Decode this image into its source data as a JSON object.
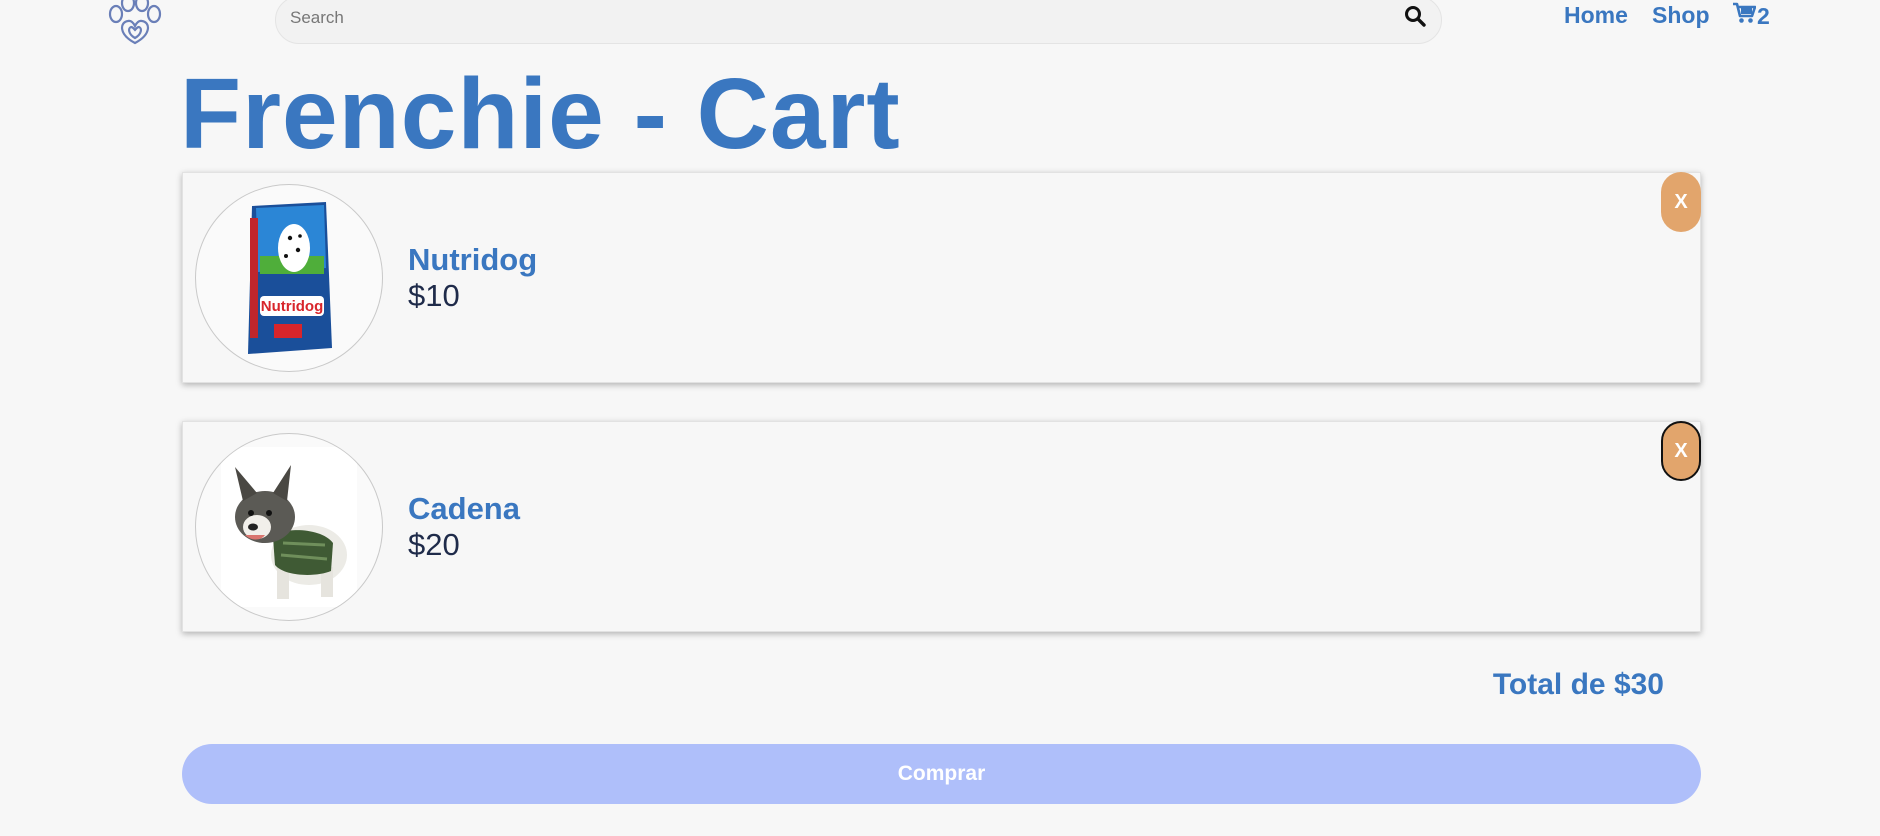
{
  "header": {
    "logo_icon": "paw-heart-logo-icon",
    "search": {
      "placeholder": "Search",
      "value": "",
      "icon": "search-icon"
    },
    "nav": {
      "home": "Home",
      "shop": "Shop",
      "cart_icon": "cart-icon",
      "cart_count": "2"
    }
  },
  "page": {
    "title": "Frenchie - Cart"
  },
  "cart": {
    "items": [
      {
        "name": "Nutridog",
        "price": "$10",
        "remove_label": "X",
        "image": "dog-food-bag-image"
      },
      {
        "name": "Cadena",
        "price": "$20",
        "remove_label": "X",
        "image": "french-bulldog-harness-image"
      }
    ],
    "total": "Total de $30",
    "buy_label": "Comprar"
  },
  "colors": {
    "accent": "#3a77c0",
    "remove_button": "#e2a56c",
    "buy_button": "#afbffa",
    "background": "#f7f7f7"
  }
}
